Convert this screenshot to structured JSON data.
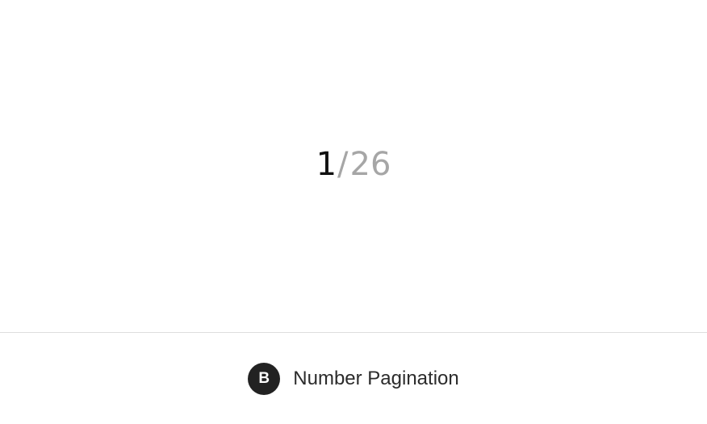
{
  "pagination": {
    "current": "1",
    "separator": "/",
    "total": "26"
  },
  "caption": {
    "badge_letter": "B",
    "title": "Number Pagination"
  },
  "colors": {
    "current_text": "#111111",
    "muted_text": "#a6a6a6",
    "badge_background": "#222222",
    "divider": "#dedede"
  }
}
